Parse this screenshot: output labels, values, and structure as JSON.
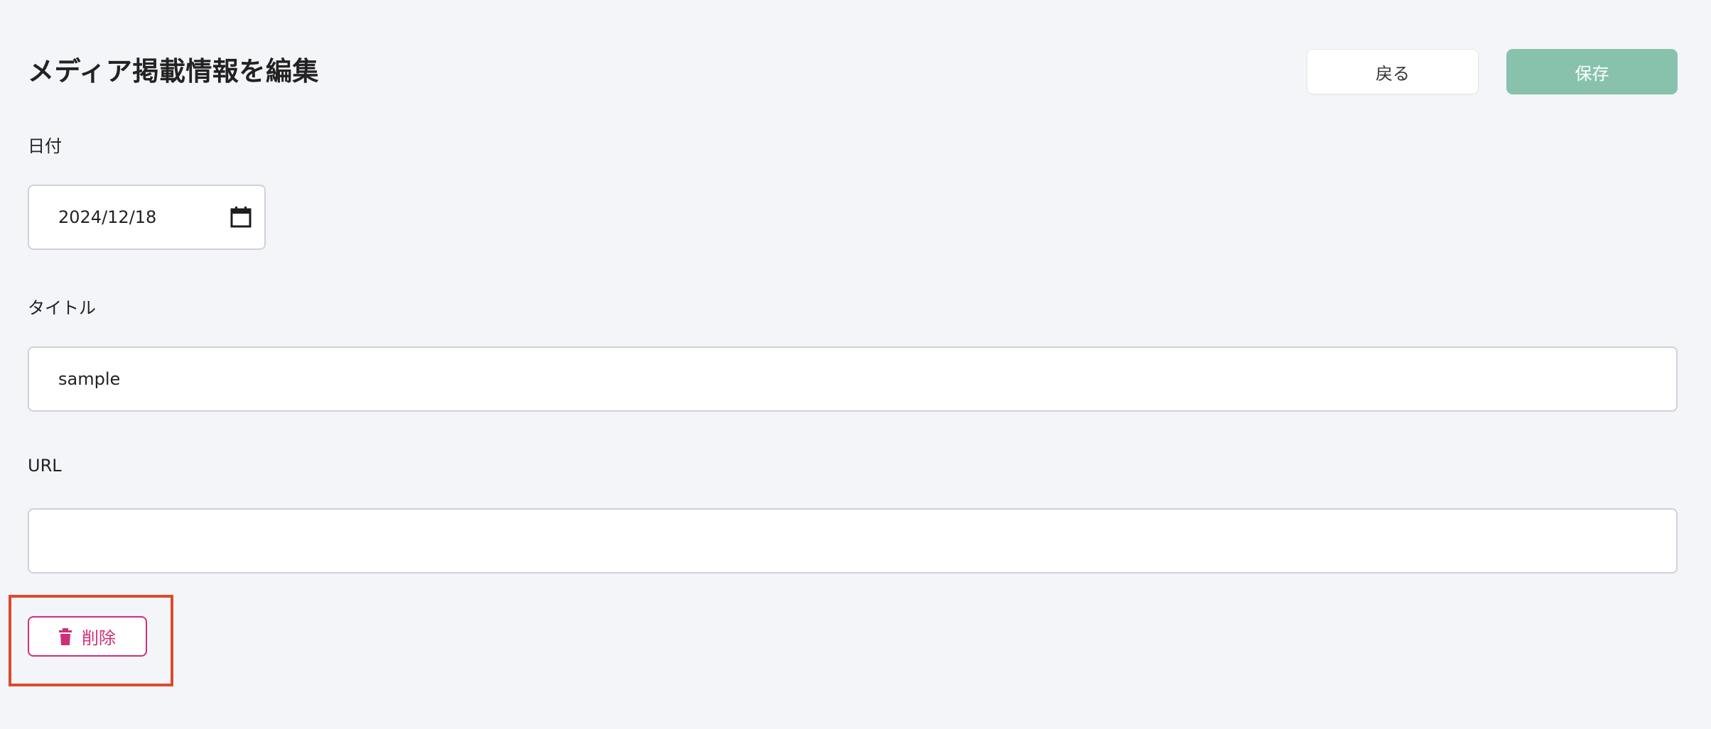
{
  "header": {
    "title": "メディア掲載情報を編集",
    "back_label": "戻る",
    "save_label": "保存"
  },
  "form": {
    "date": {
      "label": "日付",
      "value": "2024/12/18",
      "icon": "calendar-icon"
    },
    "title": {
      "label": "タイトル",
      "value": "sample"
    },
    "url": {
      "label": "URL",
      "value": ""
    }
  },
  "actions": {
    "delete_label": "削除",
    "delete_icon": "trash-icon"
  },
  "colors": {
    "background": "#f4f5f9",
    "save_button": "#88c2ad",
    "delete_accent": "#cf2f78",
    "highlight": "#dc4a2e"
  }
}
